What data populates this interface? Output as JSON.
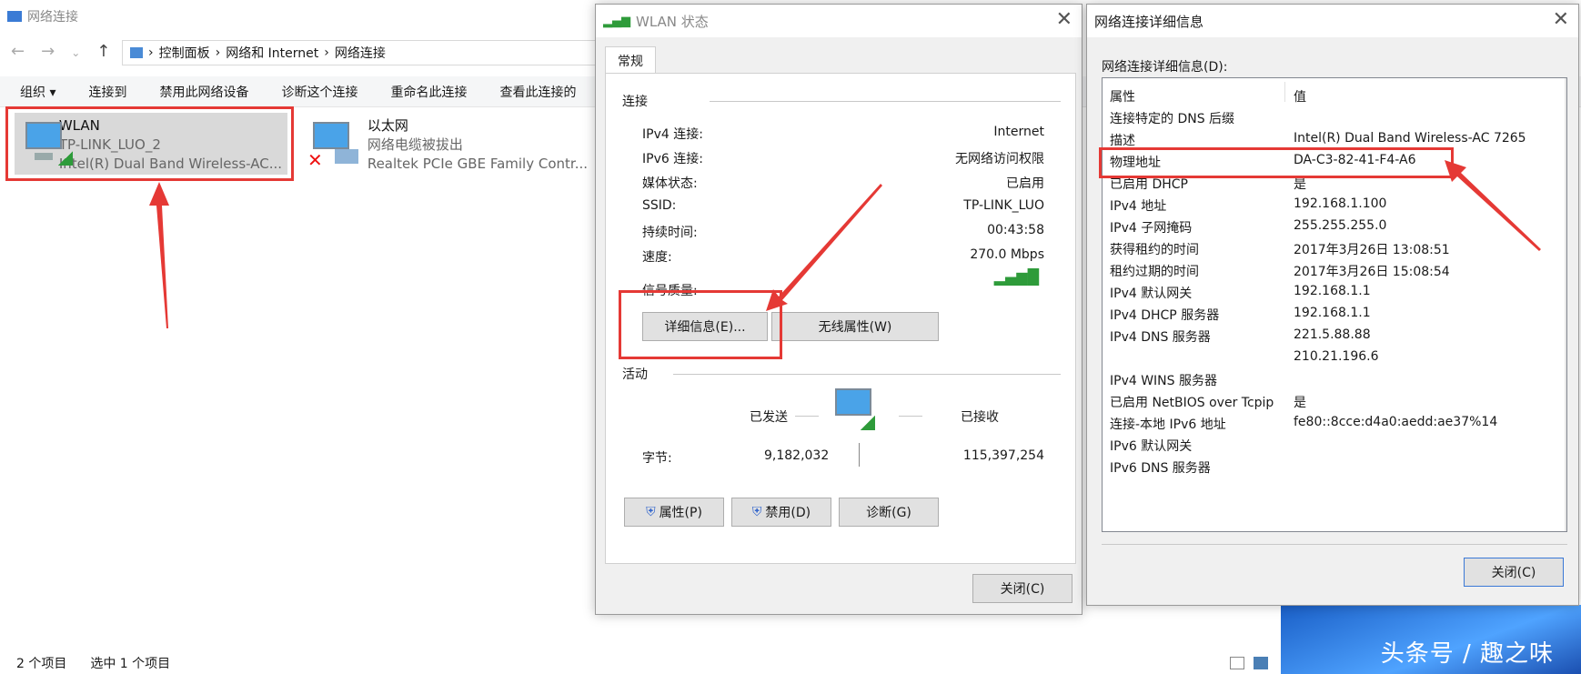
{
  "explorer": {
    "title": "网络连接",
    "breadcrumb": [
      "控制面板",
      "网络和 Internet",
      "网络连接"
    ],
    "commands": [
      "组织 ▾",
      "连接到",
      "禁用此网络设备",
      "诊断这个连接",
      "重命名此连接",
      "查看此连接的"
    ],
    "items": [
      {
        "name": "WLAN",
        "sub": "TP-LINK_LUO_2",
        "adapter": "Intel(R) Dual Band Wireless-AC..."
      },
      {
        "name": "以太网",
        "sub": "网络电缆被拔出",
        "adapter": "Realtek PCIe GBE Family Contr..."
      }
    ],
    "status_count": "2 个项目",
    "status_selected": "选中 1 个项目"
  },
  "wlan": {
    "title": "WLAN 状态",
    "tab": "常规",
    "section_conn": "连接",
    "rows": [
      {
        "k": "IPv4 连接:",
        "v": "Internet"
      },
      {
        "k": "IPv6 连接:",
        "v": "无网络访问权限"
      },
      {
        "k": "媒体状态:",
        "v": "已启用"
      },
      {
        "k": "SSID:",
        "v": "TP-LINK_LUO"
      },
      {
        "k": "持续时间:",
        "v": "00:43:58"
      },
      {
        "k": "速度:",
        "v": "270.0 Mbps"
      }
    ],
    "signal_label": "信号质量:",
    "details_button": "详细信息(E)...",
    "wireless_button": "无线属性(W)",
    "section_activity": "活动",
    "sent": "已发送",
    "received": "已接收",
    "bytes_label": "字节:",
    "bytes_sent": "9,182,032",
    "bytes_received": "115,397,254",
    "props_button": "属性(P)",
    "disable_button": "禁用(D)",
    "diagnose_button": "诊断(G)",
    "close_button": "关闭(C)"
  },
  "details": {
    "title": "网络连接详细信息",
    "label": "网络连接详细信息(D):",
    "col_prop": "属性",
    "col_val": "值",
    "rows": [
      {
        "k": "连接特定的 DNS 后缀",
        "v": ""
      },
      {
        "k": "描述",
        "v": "Intel(R) Dual Band Wireless-AC 7265"
      },
      {
        "k": "物理地址",
        "v": "DA-C3-82-41-F4-A6"
      },
      {
        "k": "已启用 DHCP",
        "v": "是"
      },
      {
        "k": "IPv4 地址",
        "v": "192.168.1.100"
      },
      {
        "k": "IPv4 子网掩码",
        "v": "255.255.255.0"
      },
      {
        "k": "获得租约的时间",
        "v": "2017年3月26日 13:08:51"
      },
      {
        "k": "租约过期的时间",
        "v": "2017年3月26日 15:08:54"
      },
      {
        "k": "IPv4 默认网关",
        "v": "192.168.1.1"
      },
      {
        "k": "IPv4 DHCP 服务器",
        "v": "192.168.1.1"
      },
      {
        "k": "IPv4 DNS 服务器",
        "v": "221.5.88.88"
      },
      {
        "k": "",
        "v": "210.21.196.6"
      },
      {
        "k": "IPv4 WINS 服务器",
        "v": ""
      },
      {
        "k": "已启用 NetBIOS over Tcpip",
        "v": "是"
      },
      {
        "k": "连接-本地 IPv6 地址",
        "v": "fe80::8cce:d4a0:aedd:ae37%14"
      },
      {
        "k": "IPv6 默认网关",
        "v": ""
      },
      {
        "k": "IPv6 DNS 服务器",
        "v": ""
      }
    ],
    "close_button": "关闭(C)"
  },
  "watermark": "头条号 / 趣之味"
}
